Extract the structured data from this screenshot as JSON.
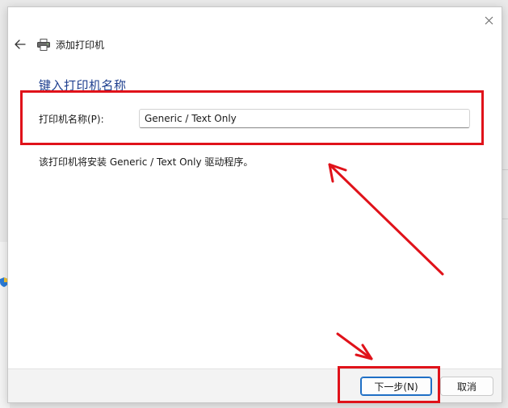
{
  "dialog": {
    "wizard_title": "添加打印机",
    "heading": "键入打印机名称",
    "name_label": "打印机名称(P):",
    "name_value": "Generic / Text Only",
    "description": "该打印机将安装 Generic / Text Only 驱动程序。",
    "next_label": "下一步(N)",
    "cancel_label": "取消"
  },
  "icons": {
    "close": "close-icon",
    "back": "back-arrow-icon",
    "printer": "printer-icon"
  },
  "colors": {
    "accent": "#1f6fc5",
    "heading": "#1e3f8f",
    "annotation": "#e0121a"
  }
}
